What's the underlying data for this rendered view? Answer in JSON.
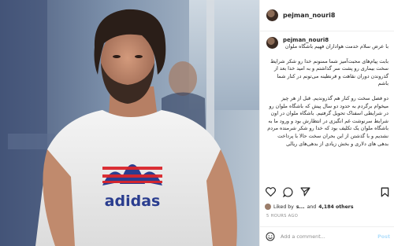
{
  "header": {
    "username": "pejman_nouri8"
  },
  "caption": {
    "username": "pejman_nouri8",
    "greeting": "با عرض سلام خدمت هواداران فهیم باشگاه ملوان",
    "paragraph1": "بابت پیام‌های محبت‌آمیز شما ممنونم خدا رو شکر شرایط سخت بیماری رو پشت سر گذاشتم و به امید خدا بعد از گذروندن دوران نقاهت و قرنطینه می‌تونم در کنار شما باشم",
    "paragraph2": "دو فصل سخت رو کنار هم گذروندیم. قبل از هر چیز میخوام برگردم به حدود دو سال پیش که باشگاه ملوان رو در شرایطی اسفناک تحویل گرفتیم. باشگاه ملوان در اون شرایط سرنوشت غم انگیزی در انتظارش بود و ورود ما به باشگاه ملوان یک تکلیف بود که خدا رو شکر شرمنده مردم نشدیم و با گذشتن از این بحران سخت حالا با پرداخت بدهی های دلاری و بخش زیادی از بدهی‌های ریالی"
  },
  "likes": {
    "prefix": "Liked by",
    "names": "s...",
    "and": "and",
    "count": "4,184 others"
  },
  "time_ago": "5 HOURS AGO",
  "comment_box": {
    "placeholder": "Add a comment...",
    "post_label": "Post"
  },
  "photo": {
    "shirt_brand": "adidas"
  },
  "colors": {
    "stripe_red": "#d9252b",
    "stripe_blue": "#2a3d8f",
    "post_disabled": "#b2dffc"
  }
}
